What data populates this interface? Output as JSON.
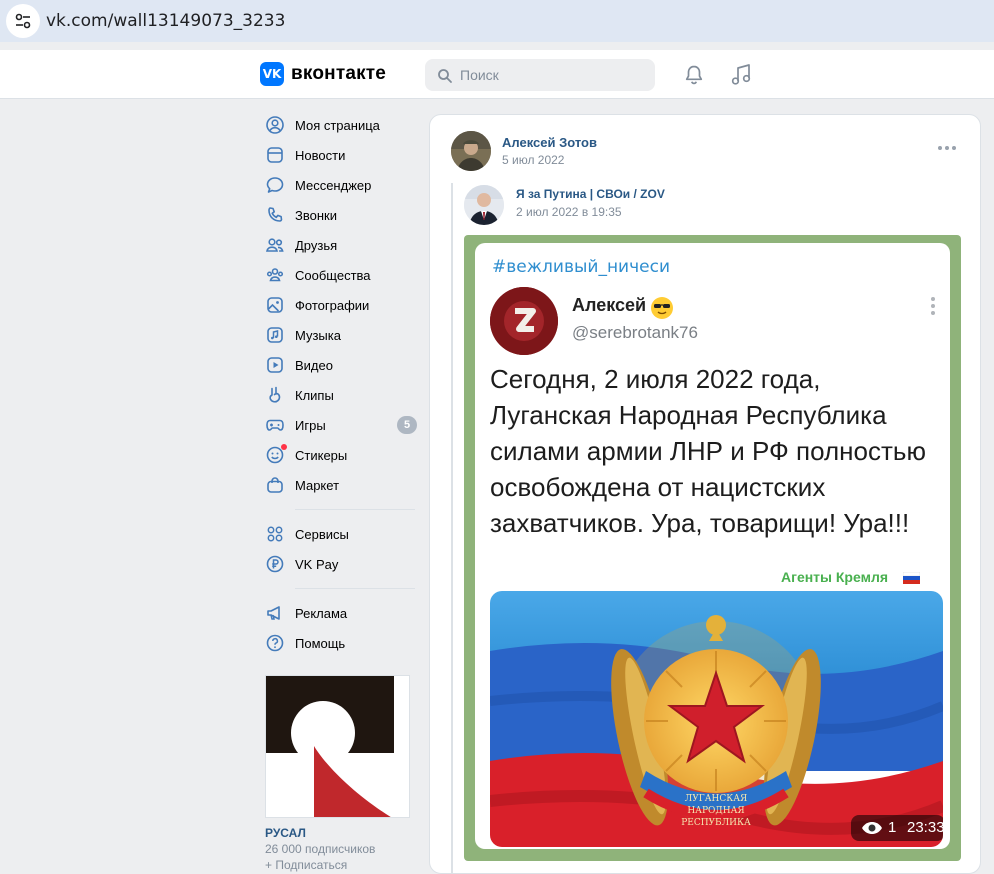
{
  "browser": {
    "url": "vk.com/wall13149073_3233"
  },
  "header": {
    "logo_badge": "VK",
    "logo_text": "вконтакте",
    "search_placeholder": "Поиск",
    "icons": [
      "bell-icon",
      "music-icon"
    ]
  },
  "sidebar": {
    "items": [
      {
        "label": "Моя страница",
        "icon": "user-circle-icon"
      },
      {
        "label": "Новости",
        "icon": "news-icon"
      },
      {
        "label": "Мессенджер",
        "icon": "chat-bubble-icon"
      },
      {
        "label": "Звонки",
        "icon": "phone-icon"
      },
      {
        "label": "Друзья",
        "icon": "friends-icon"
      },
      {
        "label": "Сообщества",
        "icon": "communities-icon"
      },
      {
        "label": "Фотографии",
        "icon": "photo-icon"
      },
      {
        "label": "Музыка",
        "icon": "music-icon"
      },
      {
        "label": "Видео",
        "icon": "video-icon"
      },
      {
        "label": "Клипы",
        "icon": "clips-icon"
      },
      {
        "label": "Игры",
        "icon": "gamepad-icon",
        "badge": "5"
      },
      {
        "label": "Стикеры",
        "icon": "sticker-icon",
        "dot": true
      },
      {
        "label": "Маркет",
        "icon": "bag-icon"
      },
      {
        "label": "Сервисы",
        "icon": "grid-icon"
      },
      {
        "label": "VK Pay",
        "icon": "ruble-icon"
      },
      {
        "label": "Реклама",
        "icon": "megaphone-icon"
      },
      {
        "label": "Помощь",
        "icon": "help-icon"
      }
    ],
    "ad": {
      "name": "РУСАЛ",
      "subscribers": "26 000 подписчиков",
      "follow": "+ Подписаться"
    }
  },
  "post": {
    "author": "Алексей Зотов",
    "date": "5 июл 2022",
    "repost": {
      "source_name": "Я за Путина | СВОи / ZOV",
      "source_date": "2 июл 2022 в 19:35"
    },
    "image": {
      "hashtag": "#вежливый_ничеси",
      "tweet_name": "Алексей",
      "tweet_handle": "@serebrotank76",
      "tweet_text": "Сегодня, 2 июля 2022 года, Луганская Народная Республика силами армии ЛНР и РФ полностью освобождена от нацистских захватчиков. Ура, товарищи! Ура!!!",
      "agents_label": "Агенты Кремля",
      "emblem_text": [
        "ЛУГАНСКАЯ",
        "НАРОДНАЯ",
        "РЕСПУБЛИКА"
      ],
      "views_count": "1",
      "video_time": "23:33",
      "flag_colors": [
        "#2f6fd0",
        "#1e9fe0",
        "#e01b24"
      ]
    }
  },
  "colors": {
    "accent": "#0077ff",
    "link": "#2a5885",
    "muted": "#818c99",
    "background": "#edeef0",
    "icon": "#447bba"
  }
}
